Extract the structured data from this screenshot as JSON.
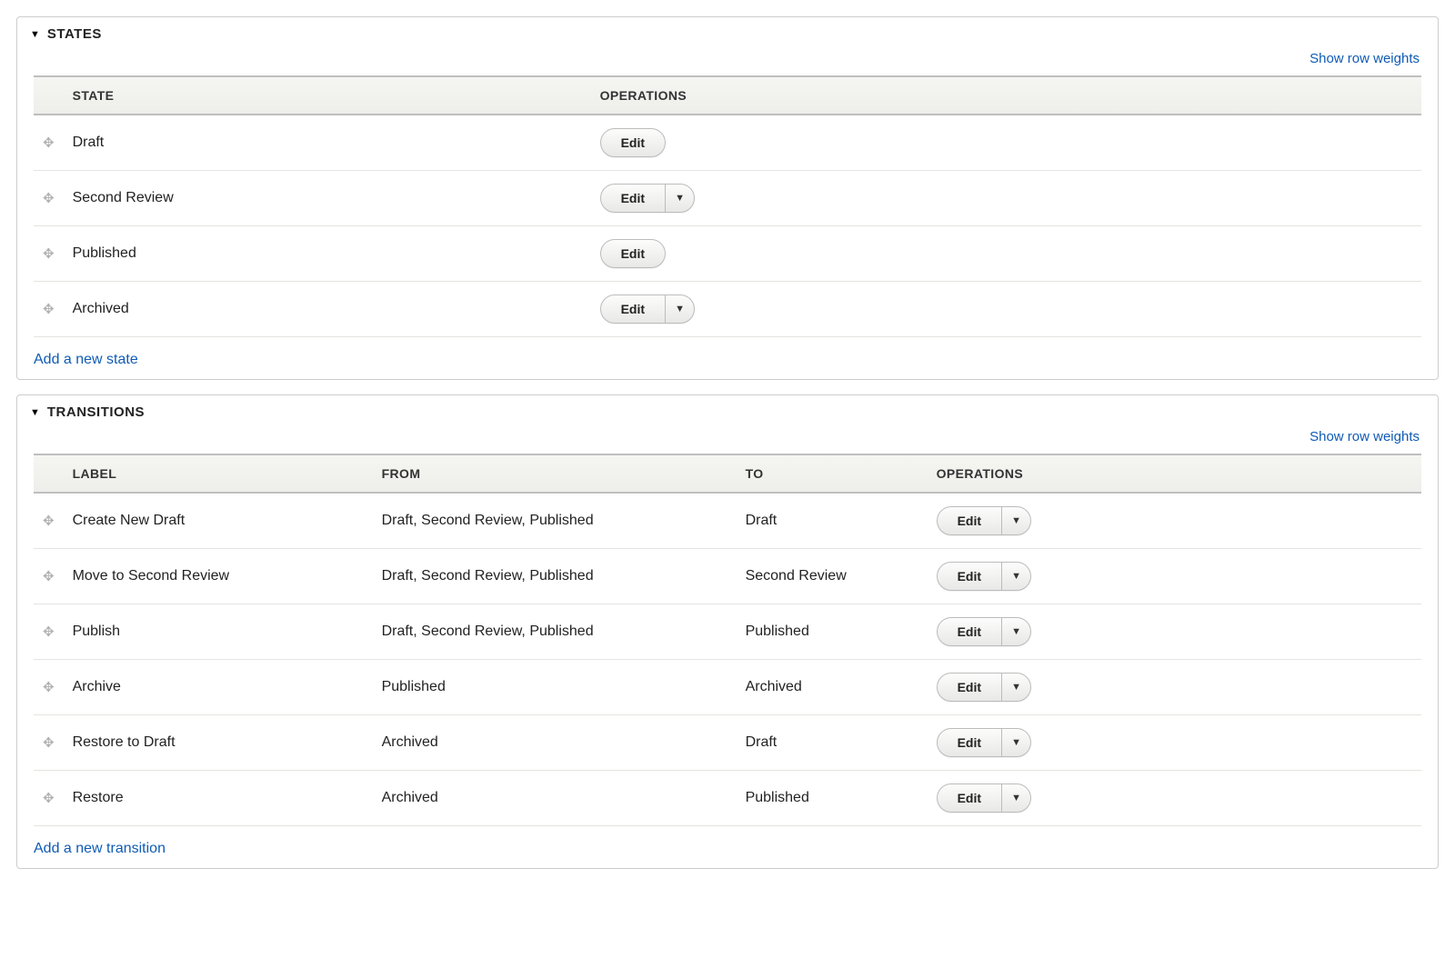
{
  "labels": {
    "show_row_weights": "Show row weights",
    "edit": "Edit"
  },
  "states_section": {
    "title": "STATES",
    "columns": {
      "state": "STATE",
      "operations": "OPERATIONS"
    },
    "rows": [
      {
        "name": "Draft",
        "has_dropdown": false
      },
      {
        "name": "Second Review",
        "has_dropdown": true
      },
      {
        "name": "Published",
        "has_dropdown": false
      },
      {
        "name": "Archived",
        "has_dropdown": true
      }
    ],
    "add_link": "Add a new state"
  },
  "transitions_section": {
    "title": "TRANSITIONS",
    "columns": {
      "label": "LABEL",
      "from": "FROM",
      "to": "TO",
      "operations": "OPERATIONS"
    },
    "rows": [
      {
        "label": "Create New Draft",
        "from": "Draft, Second Review, Published",
        "to": "Draft",
        "has_dropdown": true
      },
      {
        "label": "Move to Second Review",
        "from": "Draft, Second Review, Published",
        "to": "Second Review",
        "has_dropdown": true
      },
      {
        "label": "Publish",
        "from": "Draft, Second Review, Published",
        "to": "Published",
        "has_dropdown": true
      },
      {
        "label": "Archive",
        "from": "Published",
        "to": "Archived",
        "has_dropdown": true
      },
      {
        "label": "Restore to Draft",
        "from": "Archived",
        "to": "Draft",
        "has_dropdown": true
      },
      {
        "label": "Restore",
        "from": "Archived",
        "to": "Published",
        "has_dropdown": true
      }
    ],
    "add_link": "Add a new transition"
  }
}
